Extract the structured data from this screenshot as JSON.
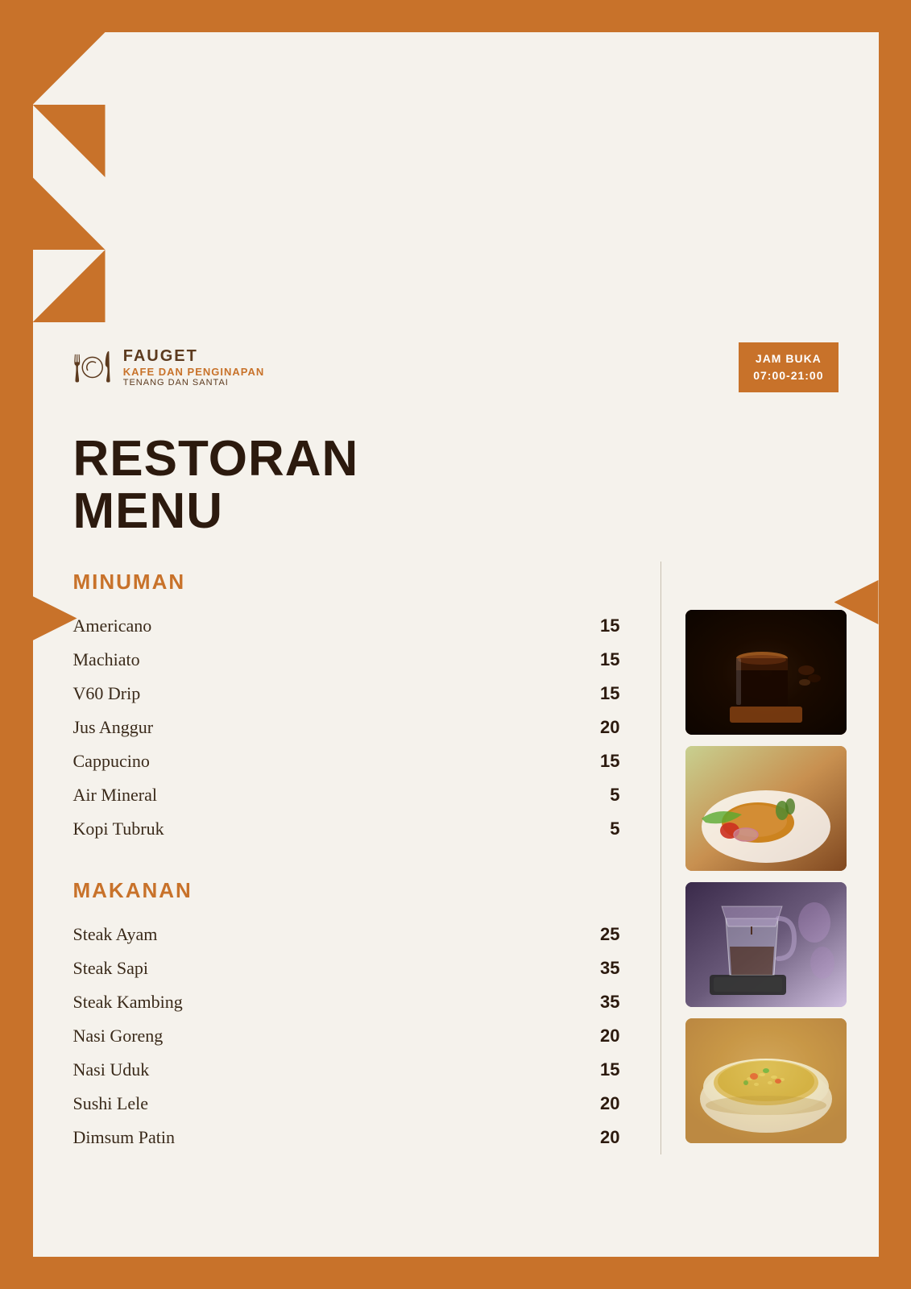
{
  "brand": {
    "name": "FAUGET",
    "subtitle": "KAFE DAN PENGINAPAN",
    "tagline": "TENANG DAN SANTAI",
    "hours_label": "JAM BUKA",
    "hours_value": "07:00-21:00"
  },
  "page_title": "RESTORAN\nMENU",
  "sections": {
    "drinks": {
      "title": "MINUMAN",
      "items": [
        {
          "name": "Americano",
          "price": "15"
        },
        {
          "name": "Machiato",
          "price": "15"
        },
        {
          "name": "V60 Drip",
          "price": "15"
        },
        {
          "name": "Jus Anggur",
          "price": "20"
        },
        {
          "name": "Cappucino",
          "price": "15"
        },
        {
          "name": "Air Mineral",
          "price": "5"
        },
        {
          "name": "Kopi Tubruk",
          "price": "5"
        }
      ]
    },
    "food": {
      "title": "MAKANAN",
      "items": [
        {
          "name": "Steak Ayam",
          "price": "25"
        },
        {
          "name": "Steak Sapi",
          "price": "35"
        },
        {
          "name": "Steak Kambing",
          "price": "35"
        },
        {
          "name": "Nasi Goreng",
          "price": "20"
        },
        {
          "name": "Nasi Uduk",
          "price": "15"
        },
        {
          "name": "Sushi Lele",
          "price": "20"
        },
        {
          "name": "Dimsum Patin",
          "price": "20"
        }
      ]
    }
  }
}
